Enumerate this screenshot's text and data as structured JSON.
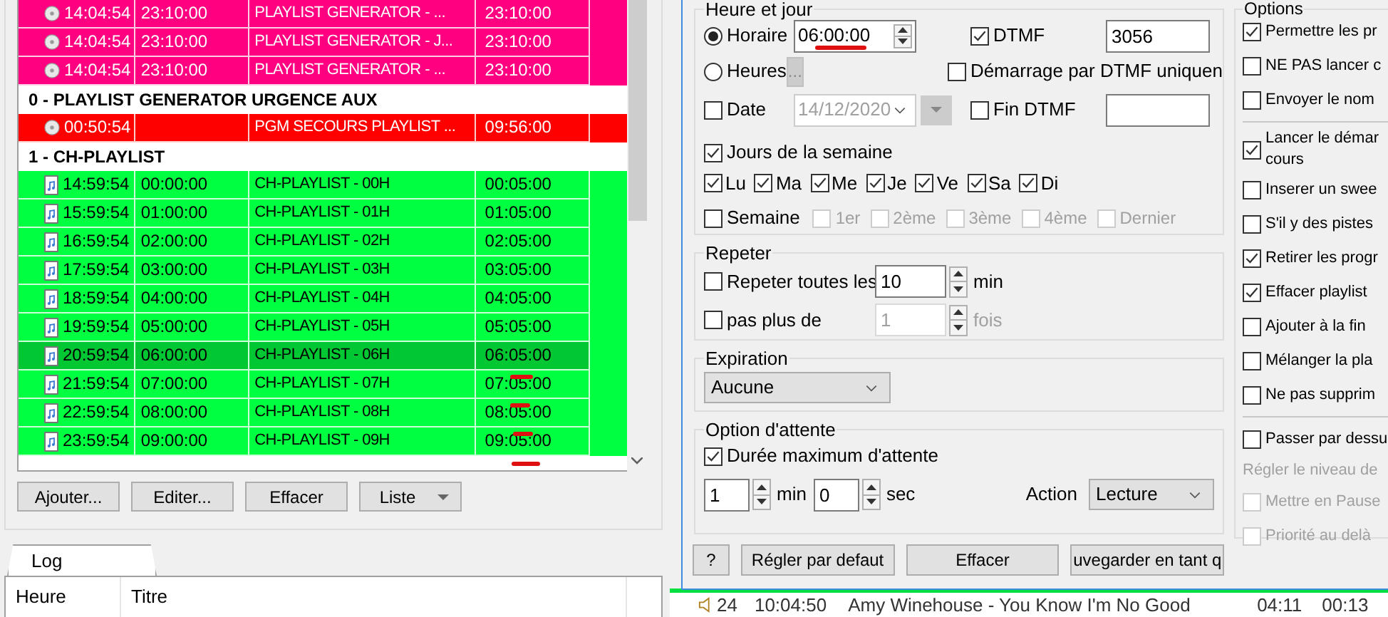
{
  "schedule_table": {
    "rows": [
      {
        "kind": "timer",
        "time": "14:04:54",
        "start": "23:10:00",
        "title": "PLAYLIST GENERATOR - ...",
        "end": "23:10:00",
        "color": "#ff0080",
        "selected": false
      },
      {
        "kind": "timer",
        "time": "14:04:54",
        "start": "23:10:00",
        "title": "PLAYLIST GENERATOR - J...",
        "end": "23:10:00",
        "color": "#ff0080",
        "selected": false
      },
      {
        "kind": "timer",
        "time": "14:04:54",
        "start": "23:10:00",
        "title": "PLAYLIST GENERATOR - ...",
        "end": "23:10:00",
        "color": "#ff0080",
        "selected": false
      },
      {
        "kind": "group",
        "label": "0 - PLAYLIST GENERATOR URGENCE AUX"
      },
      {
        "kind": "timer",
        "time": "00:50:54",
        "title": "PGM SECOURS PLAYLIST ...",
        "end": "09:56:00",
        "color": "#ff0000",
        "selected": false
      },
      {
        "kind": "group",
        "label": "1 - CH-PLAYLIST"
      },
      {
        "kind": "file",
        "time": "14:59:54",
        "start": "00:00:00",
        "title": "CH-PLAYLIST - 00H",
        "end": "00:05:00",
        "color": "#00ff40",
        "selected": false
      },
      {
        "kind": "file",
        "time": "15:59:54",
        "start": "01:00:00",
        "title": "CH-PLAYLIST - 01H",
        "end": "01:05:00",
        "color": "#00ff40",
        "selected": false
      },
      {
        "kind": "file",
        "time": "16:59:54",
        "start": "02:00:00",
        "title": "CH-PLAYLIST - 02H",
        "end": "02:05:00",
        "color": "#00ff40",
        "selected": false
      },
      {
        "kind": "file",
        "time": "17:59:54",
        "start": "03:00:00",
        "title": "CH-PLAYLIST - 03H",
        "end": "03:05:00",
        "color": "#00ff40",
        "selected": false
      },
      {
        "kind": "file",
        "time": "18:59:54",
        "start": "04:00:00",
        "title": "CH-PLAYLIST - 04H",
        "end": "04:05:00",
        "color": "#00ff40",
        "selected": false
      },
      {
        "kind": "file",
        "time": "19:59:54",
        "start": "05:00:00",
        "title": "CH-PLAYLIST - 05H",
        "end": "05:05:00",
        "color": "#00ff40",
        "selected": false
      },
      {
        "kind": "file",
        "time": "20:59:54",
        "start": "06:00:00",
        "title": "CH-PLAYLIST - 06H",
        "end": "06:05:00",
        "color": "#00ff40",
        "selected": true
      },
      {
        "kind": "file",
        "time": "21:59:54",
        "start": "07:00:00",
        "title": "CH-PLAYLIST - 07H",
        "end": "07:05:00",
        "color": "#00ff40",
        "selected": false
      },
      {
        "kind": "file",
        "time": "22:59:54",
        "start": "08:00:00",
        "title": "CH-PLAYLIST - 08H",
        "end": "08:05:00",
        "color": "#00ff40",
        "selected": false
      },
      {
        "kind": "file",
        "time": "23:59:54",
        "start": "09:00:00",
        "title": "CH-PLAYLIST - 09H",
        "end": "09:05:00",
        "color": "#00ff40",
        "selected": false
      }
    ]
  },
  "list_buttons": [
    {
      "label": "Ajouter...",
      "kind": "plain"
    },
    {
      "label": "Editer...",
      "kind": "plain"
    },
    {
      "label": "Effacer",
      "kind": "plain"
    },
    {
      "label": "Liste",
      "kind": "menu"
    }
  ],
  "log": {
    "tab": "Log",
    "columns": [
      "Heure",
      "Titre"
    ]
  },
  "log_row": {
    "number": "24",
    "time": "10:04:50",
    "title": "Amy Winehouse - You Know I'm No Good",
    "duration": "04:11",
    "column_5": "00:13"
  },
  "dialog": {
    "schedule": {
      "title": "Heure et jour",
      "horaire": {
        "label": "Horaire",
        "selected": true,
        "value": "06:00:00"
      },
      "heures": {
        "label": "Heures",
        "selected": false,
        "button": "...",
        "disabled": true
      },
      "date": {
        "label": "Date",
        "checked": false,
        "value": "14/12/2020",
        "disabled": true
      },
      "dtmf": {
        "label": "DTMF",
        "checked": true,
        "value": "3056"
      },
      "dtmf_start": {
        "label": "Démarrage par DTMF uniquen",
        "checked": false
      },
      "dtmf_end": {
        "label": "Fin DTMF",
        "checked": false
      },
      "weekdays": {
        "label": "Jours de la semaine",
        "checked": true,
        "days": [
          {
            "label": "Lu",
            "checked": true
          },
          {
            "label": "Ma",
            "checked": true
          },
          {
            "label": "Me",
            "checked": true
          },
          {
            "label": "Je",
            "checked": true
          },
          {
            "label": "Ve",
            "checked": true
          },
          {
            "label": "Sa",
            "checked": true
          },
          {
            "label": "Di",
            "checked": true
          }
        ]
      },
      "weeks": {
        "label": "Semaine",
        "checked": false,
        "items": [
          {
            "label": "1er",
            "checked": false,
            "disabled": true
          },
          {
            "label": "2ème",
            "checked": false,
            "disabled": true
          },
          {
            "label": "3ème",
            "checked": false,
            "disabled": true
          },
          {
            "label": "4ème",
            "checked": false,
            "disabled": true
          },
          {
            "label": "Dernier",
            "checked": false,
            "disabled": true
          }
        ]
      }
    },
    "repeat": {
      "title": "Repeter",
      "every": {
        "label": "Repeter toutes les",
        "checked": false,
        "value": "10",
        "unit": "min",
        "disabled": false
      },
      "max": {
        "label": "pas plus de",
        "checked": false,
        "value": "1",
        "unit": "fois",
        "disabled": true
      }
    },
    "expiration": {
      "title": "Expiration",
      "value": "Aucune"
    },
    "wait": {
      "title": "Option d'attente",
      "max_wait": {
        "label": "Durée maximum d'attente",
        "checked": true
      },
      "minutes": "1",
      "minutes_unit": "min",
      "seconds": "0",
      "seconds_unit": "sec",
      "action_label": "Action",
      "action": "Lecture"
    },
    "buttons": [
      "?",
      "Régler par defaut",
      "Effacer",
      "uvegarder en tant q"
    ],
    "options": {
      "title": "Options",
      "items": [
        {
          "kind": "checkbox",
          "label": "Permettre les pr",
          "checked": true,
          "disabled": false
        },
        {
          "kind": "checkbox",
          "label": "NE PAS lancer c",
          "checked": false,
          "disabled": false
        },
        {
          "kind": "checkbox",
          "label": "Envoyer le nom",
          "checked": false,
          "disabled": false
        },
        {
          "kind": "separator"
        },
        {
          "kind": "checkbox",
          "label": "Lancer le démar",
          "label_2": "cours",
          "checked": true,
          "disabled": false
        },
        {
          "kind": "checkbox",
          "label": "Inserer un swee",
          "checked": false,
          "disabled": false
        },
        {
          "kind": "checkbox",
          "label": "S'il y des pistes",
          "checked": false,
          "disabled": false
        },
        {
          "kind": "checkbox",
          "label": "Retirer les progr",
          "checked": true,
          "disabled": false
        },
        {
          "kind": "checkbox",
          "label": "Effacer playlist",
          "checked": true,
          "disabled": false
        },
        {
          "kind": "checkbox",
          "label": "Ajouter à la fin",
          "checked": false,
          "disabled": false
        },
        {
          "kind": "checkbox",
          "label": "Mélanger la pla",
          "checked": false,
          "disabled": false
        },
        {
          "kind": "checkbox",
          "label": "Ne pas supprim",
          "checked": false,
          "disabled": false
        },
        {
          "kind": "separator"
        },
        {
          "kind": "checkbox",
          "label": "Passer par dessu",
          "checked": false,
          "disabled": false
        },
        {
          "kind": "label",
          "label": "Régler le niveau de"
        },
        {
          "kind": "checkbox",
          "label": "Mettre en Pause",
          "checked": false,
          "disabled": true
        },
        {
          "kind": "checkbox",
          "label": "Priorité au delà",
          "checked": false,
          "disabled": true
        }
      ]
    }
  }
}
